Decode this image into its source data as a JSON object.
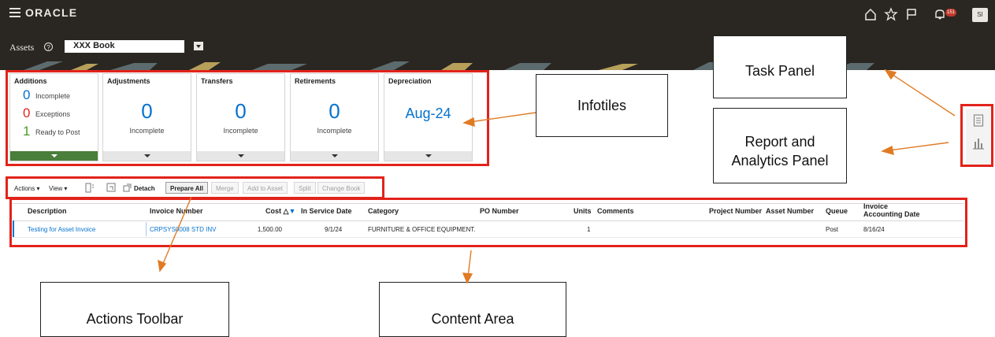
{
  "header": {
    "brand": "ORACLE",
    "notification_count": "151",
    "user_initials": "SI"
  },
  "assets_bar": {
    "label": "Assets",
    "book_value": "XXX Book"
  },
  "tiles": [
    {
      "title": "Additions",
      "rows": [
        {
          "value": "0",
          "label": "Incomplete",
          "color": "#0572ce"
        },
        {
          "value": "0",
          "label": "Exceptions",
          "color": "#e2231a"
        },
        {
          "value": "1",
          "label": "Ready to Post",
          "color": "#4a9c2d"
        }
      ]
    },
    {
      "title": "Adjustments",
      "value": "0",
      "sub": "Incomplete"
    },
    {
      "title": "Transfers",
      "value": "0",
      "sub": "Incomplete"
    },
    {
      "title": "Retirements",
      "value": "0",
      "sub": "Incomplete"
    },
    {
      "title": "Depreciation",
      "value": "Aug-24"
    }
  ],
  "toolbar": {
    "actions": "Actions",
    "view": "View",
    "detach": "Detach",
    "prepare_all": "Prepare All",
    "merge": "Merge",
    "add_to_asset": "Add to Asset",
    "split": "Split",
    "change_book": "Change Book"
  },
  "table": {
    "columns": {
      "description": "Description",
      "invoice_number": "Invoice Number",
      "cost": "Cost",
      "in_service_date": "In Service Date",
      "category": "Category",
      "po_number": "PO Number",
      "units": "Units",
      "comments": "Comments",
      "project_number": "Project Number",
      "asset_number": "Asset Number",
      "queue": "Queue",
      "invoice_accounting_date_1": "Invoice",
      "invoice_accounting_date_2": "Accounting Date"
    },
    "rows": [
      {
        "description": "Testing for Asset Invoice",
        "invoice_number": "CRPSYS0008 STD INV",
        "cost": "1,500.00",
        "in_service_date": "9/1/24",
        "category": "FURNITURE & OFFICE EQUIPMENT.",
        "units": "1",
        "queue": "Post",
        "invoice_accounting_date": "8/16/24"
      }
    ]
  },
  "annotations": {
    "infotiles": "Infotiles",
    "task_panel": "Task Panel",
    "report_panel_1": "Report and",
    "report_panel_2": "Analytics Panel",
    "actions_toolbar": "Actions Toolbar",
    "content_area": "Content Area",
    "annotation_color": "#e2231a",
    "arrow_color": "#e07b24"
  }
}
